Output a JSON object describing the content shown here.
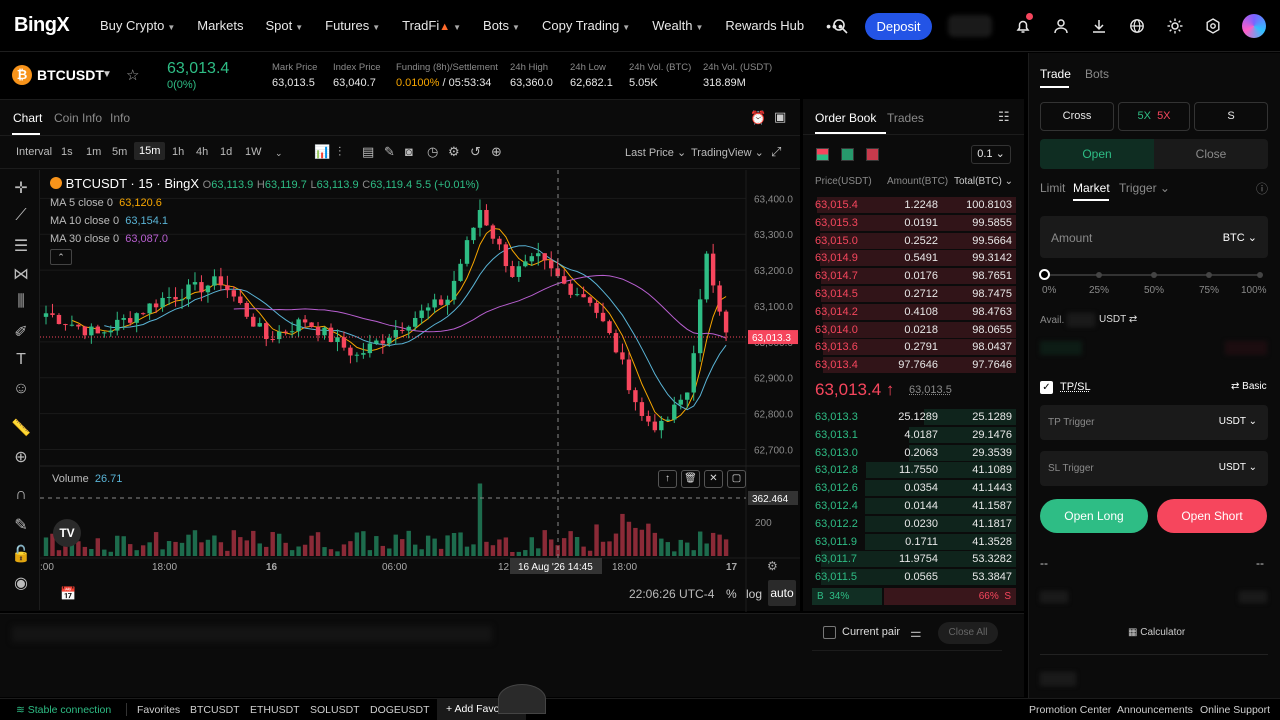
{
  "nav": {
    "logo": "BingX",
    "items": [
      "Buy Crypto",
      "Markets",
      "Spot",
      "Futures",
      "TradFi",
      "Bots",
      "Copy Trading",
      "Wealth",
      "Rewards Hub"
    ],
    "more": "•••",
    "deposit": "Deposit",
    "icons": [
      "search-icon",
      "bell-icon",
      "user-icon",
      "download-icon",
      "globe-icon",
      "theme-icon",
      "settings-icon"
    ]
  },
  "ticker": {
    "symbol": "BTCUSDT",
    "coin_glyph": "₿",
    "last_price": "63,013.4",
    "change": "0(0%)",
    "stats": [
      {
        "label": "Mark Price",
        "value": "63,013.5"
      },
      {
        "label": "Index Price",
        "value": "63,040.7"
      },
      {
        "label": "Funding (8h)/Settlement",
        "value": "0.0100%",
        "value2": " / 05:53:34"
      },
      {
        "label": "24h High",
        "value": "63,360.0"
      },
      {
        "label": "24h Low",
        "value": "62,682.1"
      },
      {
        "label": "24h Vol. (BTC)",
        "value": "5.05K"
      },
      {
        "label": "24h Vol. (USDT)",
        "value": "318.89M"
      }
    ]
  },
  "chart_tabs": [
    "Chart",
    "Coin Info",
    "Info"
  ],
  "toolbar": {
    "interval_label": "Interval",
    "timeframes": [
      "1s",
      "1m",
      "5m",
      "15m",
      "1h",
      "4h",
      "1d",
      "1W"
    ],
    "active_tf": "15m",
    "last_price": "Last Price",
    "trading_view": "TradingView"
  },
  "legend": {
    "title": "BTCUSDT · 15 · BingX",
    "ohlc": {
      "o": "63,113.9",
      "h": "63,119.7",
      "l": "63,113.9",
      "c": "63,119.4",
      "chg": "5.5 (+0.01%)"
    },
    "ma": [
      {
        "label": "MA 5 close 0",
        "value": "63,120.6",
        "color": "#f7a600"
      },
      {
        "label": "MA 10 close 0",
        "value": "63,154.1",
        "color": "#5ab4d6"
      },
      {
        "label": "MA 30 close 0",
        "value": "63,087.0",
        "color": "#b85fd0"
      }
    ],
    "volume_label": "Volume",
    "volume_value": "26.71"
  },
  "chart_data": {
    "type": "candlestick",
    "y_ticks": [
      "63,400.0",
      "63,300.0",
      "63,200.0",
      "63,100.0",
      "63,000.0",
      "62,900.0",
      "62,800.0",
      "62,700.0"
    ],
    "ylim": [
      62665,
      63440
    ],
    "current_price_label": "63,013.3",
    "volume_ticks": [
      "200"
    ],
    "volume_cursor_label": "362.464",
    "x_ticks": [
      ":00",
      "18:00",
      "16",
      "06:00",
      "12:00",
      "18:00",
      "17"
    ],
    "crosshair_label": "16 Aug '26   14:45",
    "time_readout": "22:06:26 UTC-4",
    "scale_buttons": [
      "%",
      "log",
      "auto"
    ]
  },
  "orderbook": {
    "tabs": [
      "Order Book",
      "Trades"
    ],
    "precision": "0.1",
    "headers": [
      "Price(USDT)",
      "Amount(BTC)",
      "Total(BTC)"
    ],
    "asks": [
      [
        "63,015.4",
        "1.2248",
        "100.8103"
      ],
      [
        "63,015.3",
        "0.0191",
        "99.5855"
      ],
      [
        "63,015.0",
        "0.2522",
        "99.5664"
      ],
      [
        "63,014.9",
        "0.5491",
        "99.3142"
      ],
      [
        "63,014.7",
        "0.0176",
        "98.7651"
      ],
      [
        "63,014.5",
        "0.2712",
        "98.7475"
      ],
      [
        "63,014.2",
        "0.4108",
        "98.4763"
      ],
      [
        "63,014.0",
        "0.0218",
        "98.0655"
      ],
      [
        "63,013.6",
        "0.2791",
        "98.0437"
      ],
      [
        "63,013.4",
        "97.7646",
        "97.7646"
      ]
    ],
    "mid_price": "63,013.4",
    "mid_mark": "63,013.5",
    "bids": [
      [
        "63,013.3",
        "25.1289",
        "25.1289"
      ],
      [
        "63,013.1",
        "4.0187",
        "29.1476"
      ],
      [
        "63,013.0",
        "0.2063",
        "29.3539"
      ],
      [
        "63,012.8",
        "11.7550",
        "41.1089"
      ],
      [
        "63,012.6",
        "0.0354",
        "41.1443"
      ],
      [
        "63,012.4",
        "0.0144",
        "41.1587"
      ],
      [
        "63,012.2",
        "0.0230",
        "41.1817"
      ],
      [
        "63,011.9",
        "0.1711",
        "41.3528"
      ],
      [
        "63,011.7",
        "11.9754",
        "53.3282"
      ],
      [
        "63,011.5",
        "0.0565",
        "53.3847"
      ]
    ],
    "buy_label": "B",
    "buy_pct": "34%",
    "sell_pct": "66%",
    "sell_label": "S"
  },
  "trade": {
    "tabs": [
      "Trade",
      "Bots"
    ],
    "margin": "Cross",
    "leverage_long": "5X",
    "leverage_short": "5X",
    "mode": "S",
    "open": "Open",
    "close": "Close",
    "order_types": [
      "Limit",
      "Market",
      "Trigger"
    ],
    "amount_placeholder": "Amount",
    "amount_unit": "BTC",
    "slider_marks": [
      "0%",
      "25%",
      "50%",
      "75%",
      "100%"
    ],
    "avail_label": "Avail.",
    "avail_unit": "USDT",
    "tpsl": "TP/SL",
    "basic": "Basic",
    "tp_trigger": "TP Trigger",
    "sl_trigger": "SL Trigger",
    "trigger_unit": "USDT",
    "open_long": "Open Long",
    "open_short": "Open Short",
    "dash": "--",
    "calculator": "Calculator"
  },
  "bottom": {
    "current_pair": "Current pair",
    "close_all": "Close All"
  },
  "status": {
    "connection": "Stable connection",
    "favorites": "Favorites",
    "pairs": [
      "BTCUSDT",
      "ETHUSDT",
      "SOLUSDT",
      "DOGEUSDT"
    ],
    "add_favorites": "Add Favorites",
    "links": [
      "Promotion Center",
      "Announcements",
      "Online Support"
    ]
  }
}
